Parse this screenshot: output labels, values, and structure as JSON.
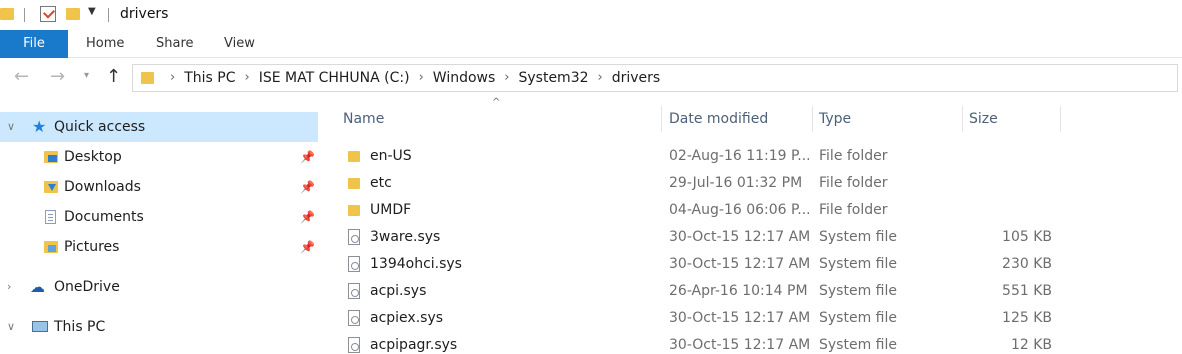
{
  "window": {
    "title": "drivers"
  },
  "ribbon": {
    "tabs": [
      "File",
      "Home",
      "Share",
      "View"
    ]
  },
  "address": {
    "crumbs": [
      "This PC",
      "ISE MAT CHHUNA (C:)",
      "Windows",
      "System32",
      "drivers"
    ]
  },
  "nav": {
    "items": [
      {
        "label": "Quick access"
      },
      {
        "label": "Desktop"
      },
      {
        "label": "Downloads"
      },
      {
        "label": "Documents"
      },
      {
        "label": "Pictures"
      },
      {
        "label": "OneDrive"
      },
      {
        "label": "This PC"
      }
    ]
  },
  "columns": {
    "name": "Name",
    "date": "Date modified",
    "type": "Type",
    "size": "Size"
  },
  "files": [
    {
      "name": "en-US",
      "date": "02-Aug-16 11:19 P...",
      "type": "File folder",
      "size": ""
    },
    {
      "name": "etc",
      "date": "29-Jul-16 01:32 PM",
      "type": "File folder",
      "size": ""
    },
    {
      "name": "UMDF",
      "date": "04-Aug-16 06:06 P...",
      "type": "File folder",
      "size": ""
    },
    {
      "name": "3ware.sys",
      "date": "30-Oct-15 12:17 AM",
      "type": "System file",
      "size": "105 KB"
    },
    {
      "name": "1394ohci.sys",
      "date": "30-Oct-15 12:17 AM",
      "type": "System file",
      "size": "230 KB"
    },
    {
      "name": "acpi.sys",
      "date": "26-Apr-16 10:14 PM",
      "type": "System file",
      "size": "551 KB"
    },
    {
      "name": "acpiex.sys",
      "date": "30-Oct-15 12:17 AM",
      "type": "System file",
      "size": "125 KB"
    },
    {
      "name": "acpipagr.sys",
      "date": "30-Oct-15 12:17 AM",
      "type": "System file",
      "size": "12 KB"
    }
  ],
  "colors": {
    "accent": "#1979ca",
    "highlight": "#ffff33",
    "selection": "#cce8ff"
  }
}
